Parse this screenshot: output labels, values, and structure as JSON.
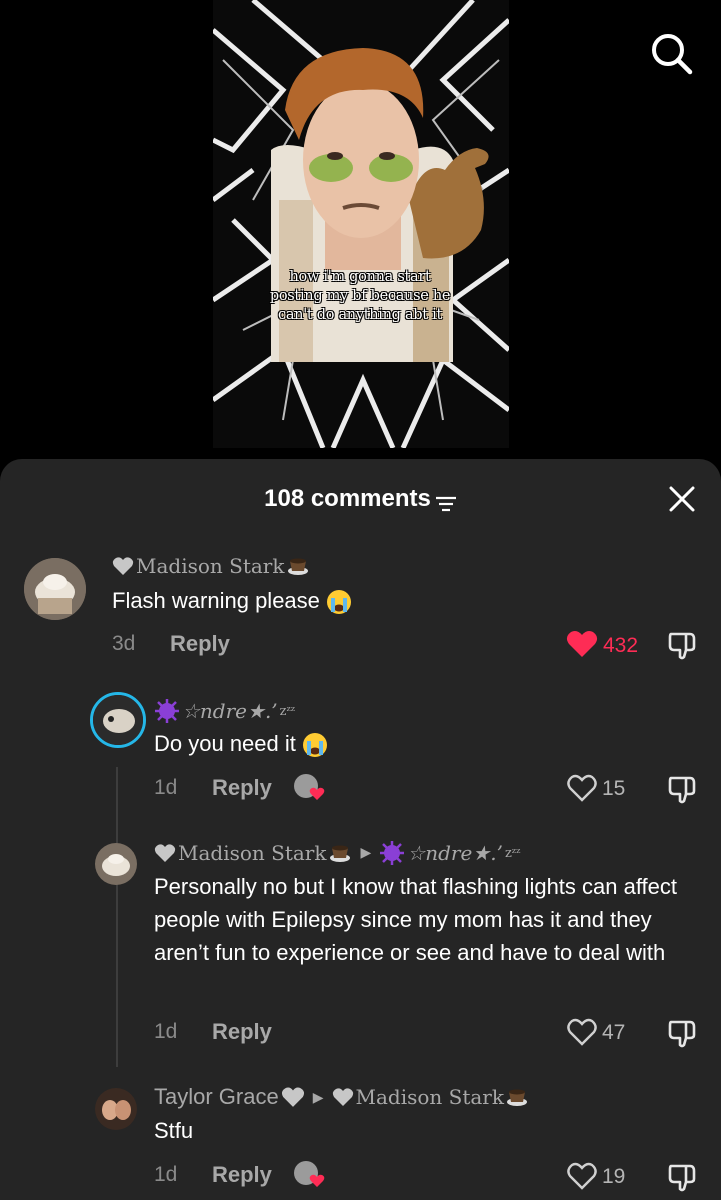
{
  "video": {
    "caption": "how i'm gonna start posting my bf because he can't do anything abt it"
  },
  "sheet": {
    "comment_count": "108 comments"
  },
  "comments": [
    {
      "username": "Madison Stark",
      "text": "Flash warning please",
      "age": "3d",
      "reply_label": "Reply",
      "likes": "432",
      "liked": true
    },
    {
      "username": "☆ndre★.’",
      "text": "Do you need it",
      "age": "1d",
      "reply_label": "Reply",
      "likes": "15"
    },
    {
      "username": "Madison Stark",
      "reply_to": "☆ndre★.’",
      "text": "Personally no but I know that flashing lights can affect people with Epilepsy since my mom has it and they aren’t fun to experience or see and have to deal with",
      "age": "1d",
      "reply_label": "Reply",
      "likes": "47"
    },
    {
      "username": "Taylor Grace",
      "reply_to": "Madison Stark",
      "text": "Stfu",
      "age": "1d",
      "reply_label": "Reply",
      "likes": "19"
    }
  ],
  "colors": {
    "sheet_bg": "#252525",
    "like_red": "#fe2c55",
    "muted": "#a8a8a8"
  },
  "icons": [
    "search-icon",
    "filter-icon",
    "close-icon",
    "heart-icon",
    "dislike-icon",
    "creator-liked-badge"
  ]
}
